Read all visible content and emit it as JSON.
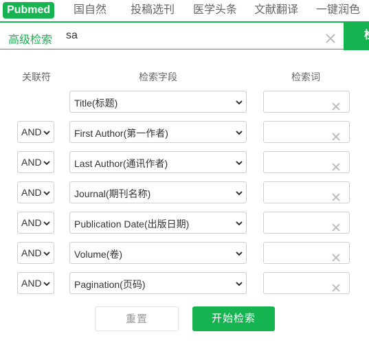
{
  "tabs": [
    {
      "label": "Pubmed",
      "active": true
    },
    {
      "label": "国自然",
      "active": false
    },
    {
      "label": "投稿选刊",
      "active": false
    },
    {
      "label": "医学头条",
      "active": false
    },
    {
      "label": "文献翻译",
      "active": false
    },
    {
      "label": "一键润色",
      "active": false
    }
  ],
  "search": {
    "advanced_label": "高级检索",
    "query": "sa",
    "go_label": "检"
  },
  "headers": {
    "relation": "关联符",
    "field": "检索字段",
    "term": "检索词"
  },
  "rows": [
    {
      "relation": "",
      "field": "Title(标题)",
      "term": ""
    },
    {
      "relation": "AND",
      "field": "First Author(第一作者)",
      "term": ""
    },
    {
      "relation": "AND",
      "field": "Last Author(通讯作者)",
      "term": ""
    },
    {
      "relation": "AND",
      "field": "Journal(期刊名称)",
      "term": ""
    },
    {
      "relation": "AND",
      "field": "Publication Date(出版日期)",
      "term": ""
    },
    {
      "relation": "AND",
      "field": "Volume(卷)",
      "term": ""
    },
    {
      "relation": "AND",
      "field": "Pagination(页码)",
      "term": ""
    }
  ],
  "buttons": {
    "reset": "重置",
    "start": "开始检索"
  },
  "colors": {
    "accent": "#16b451",
    "border": "#cfcfcf",
    "muted_text": "#666666"
  },
  "icons": {
    "clear": "close-icon",
    "dropdown": "chevron-down-icon"
  }
}
